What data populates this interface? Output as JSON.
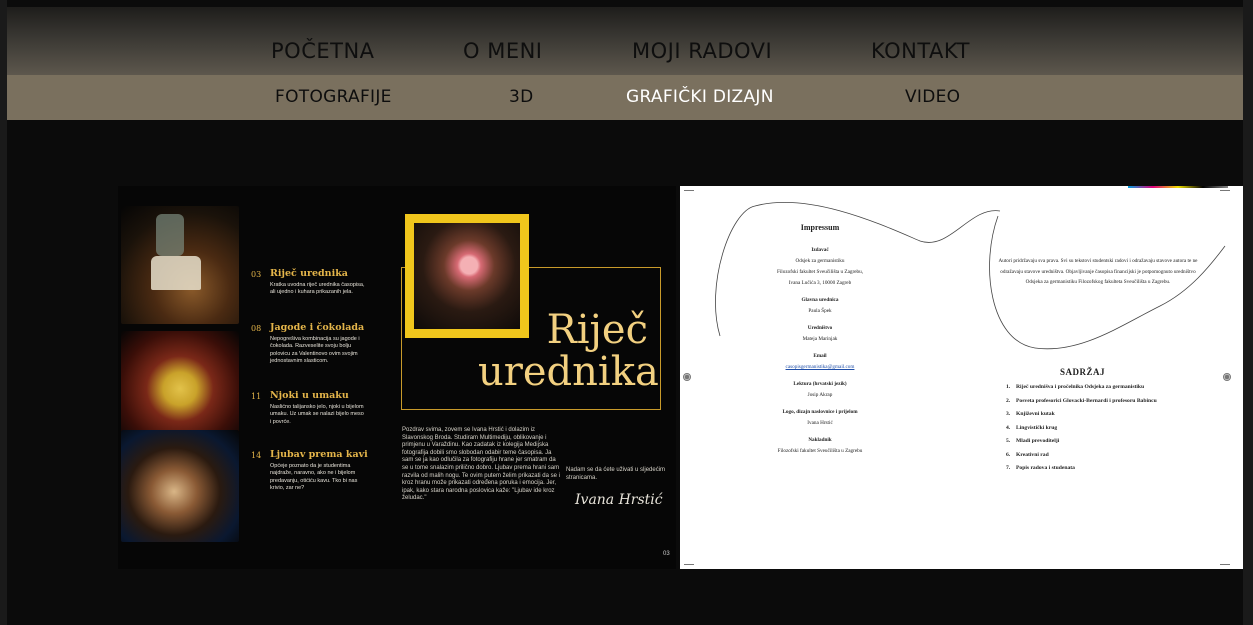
{
  "nav": {
    "main": [
      {
        "label": "POČETNA"
      },
      {
        "label": "O MENI"
      },
      {
        "label": "MOJI RADOVI"
      },
      {
        "label": "KONTAKT"
      }
    ],
    "sub": [
      {
        "label": "FOTOGRAFIJE"
      },
      {
        "label": "3D"
      },
      {
        "label": "GRAFIČKI DIZAJN"
      },
      {
        "label": "VIDEO"
      }
    ]
  },
  "spread1": {
    "toc": [
      {
        "num": "03",
        "title": "Riječ urednika",
        "desc": "Kratka uvodna riječ urednika časopisa, ali ujedno i kuhara prikazanih jela."
      },
      {
        "num": "08",
        "title": "Jagode i čokolada",
        "desc": "Nepogrešiva kombinacija su jagode i čokolada. Razveselite svoju bolju polovicu za Valentinovo ovim svojim jednostavnim slasticom."
      },
      {
        "num": "11",
        "title": "Njoki u umaku",
        "desc": "Naslićno talijansko jelo, njoki u bijelom umaku. Uz umak se nalazi bijelo meso i povrće."
      },
      {
        "num": "14",
        "title": "Ljubav prema kavi",
        "desc": "Općeje poznato da je studentima najdraže, naravno, ako ne i bijelom predavanju, otićiću kavu. Tko bi nas krivio, zar ne?"
      }
    ],
    "editor_title": "Riječ urednika",
    "editor_body": "Pozdrav svima, zovem se Ivana Hrstić i dolazim iz Slavonskog Broda. Studiram Multimediju, oblikovanje i primjenu u Varaždinu. Kao zadatak iz kolegija Medijska fotografija dobili smo slobodan odabir teme časopisa. Ja sam se ja kao odlučila za fotografiju hrane jer smatram da se u tome snalazim prilično dobro. Ljubav prema hrani sam razvila od malih nogu. Te ovim putem želim prikazati da se i kroz hranu može prikazati određena poruka i emocija. Jer, ipak, kako stara narodna poslovica kaže: \"Ljubav ide kroz želudac.\"",
    "editor_side": "Nadam se da ćete uživati u sljedećim stranicama.",
    "signature": "Ivana Hrstić",
    "page_num": "03"
  },
  "spread2": {
    "impressum": {
      "title": "Impressum",
      "izdavac_label": "Izdavač",
      "izdavac": [
        "Odsjek za germanistiku",
        "Filozofski fakultet Sveučilišta u Zagrebu,",
        "Ivana Lučića 3, 10000 Zagreb"
      ],
      "glavna_label": "Glavna urednica",
      "glavna": "Paula Špek",
      "urednistvo_label": "Uredništvo",
      "urednistvo": "Mateja Marinjak",
      "email_label": "Email",
      "email": "casopisgermanistika@gmail.com",
      "lektura_label": "Lektura (hrvatski jezik)",
      "lektura": "Josip Akrap",
      "logo_label": "Logo, dizajn naslovnice i prijelom",
      "logo": "Ivana Hrstić",
      "nakladnik_label": "Nakladnik",
      "nakladnik": "Filozofski fakultet Sveučilišta u Zagrebu"
    },
    "rights": "Autori pridržavaju sva prava. Svi su tekstovi studentski radovi i odražavaju stavove autora te ne odražavaju stavove uredništva. Objavljivanje časopisa financijski je potpomognuto uredništvo Odsjeka za germanistiku Filozofskog fakulteta Sveučilišta u Zagrebu.",
    "contents_title": "SADRŽAJ",
    "contents": [
      "Riječ urednišva i pročelnika Odsjeka za germanistiku",
      "Posveta profesorici Glovacki-Bernardi i profesoru Babincu",
      "Književni kutak",
      "Lingvistički krug",
      "Mladi prevoditelji",
      "Kreativni rad",
      "Popis radova i studenata"
    ]
  }
}
